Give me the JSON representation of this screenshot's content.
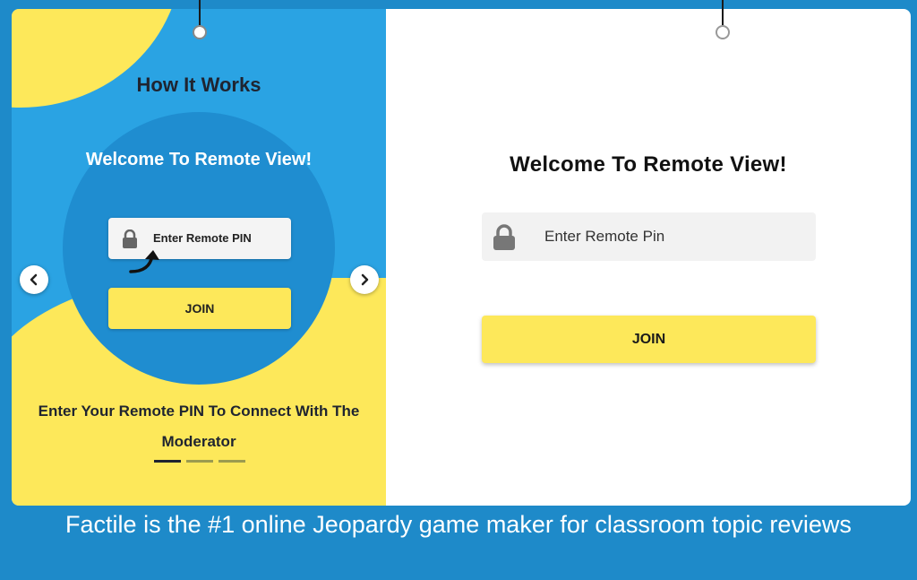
{
  "carousel": {
    "heading": "How It Works",
    "slide": {
      "title": "Welcome To Remote View!",
      "input_placeholder": "Enter Remote PIN",
      "join_label": "JOIN",
      "caption": "Enter Your Remote PIN To Connect With The Moderator"
    },
    "prev_icon": "chevron-left-icon",
    "next_icon": "chevron-right-icon",
    "slide_count": 3,
    "active_slide": 1
  },
  "remote_view": {
    "title": "Welcome To Remote View!",
    "pin_placeholder": "Enter Remote Pin",
    "lock_icon": "lock-icon",
    "join_label": "JOIN"
  },
  "footer": {
    "text": "Factile is the #1 online Jeopardy game maker for classroom topic reviews"
  },
  "colors": {
    "background": "#1e8ac9",
    "carousel_blue": "#2aa3e3",
    "accent_yellow": "#fde85a",
    "dark_text": "#1f2430"
  }
}
